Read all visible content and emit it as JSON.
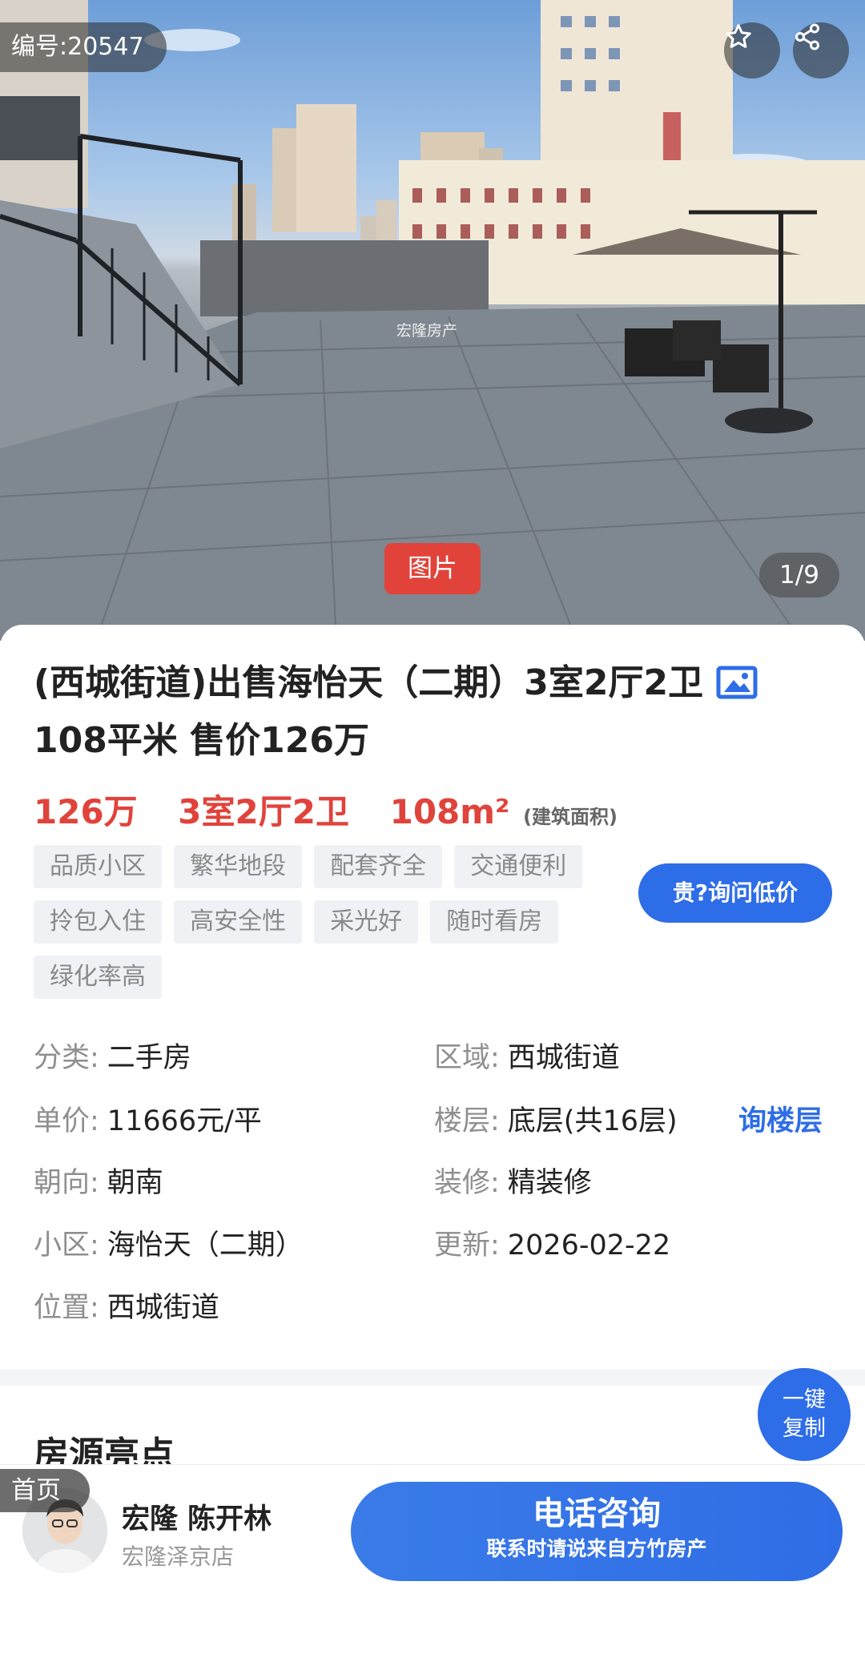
{
  "hero": {
    "listing_id": "编号:20547",
    "watermark": "宏隆房产",
    "photo_tag": "图片",
    "counter": "1/9"
  },
  "title": "(西城街道)出售海怡天（二期）3室2厅2卫",
  "title_line2": "108平米 售价126万",
  "stats": {
    "price": "126万",
    "layout": "3室2厅2卫",
    "area": "108m²",
    "area_note": "(建筑面积)"
  },
  "tags": [
    "品质小区",
    "繁华地段",
    "配套齐全",
    "交通便利",
    "拎包入住",
    "高安全性",
    "采光好",
    "随时看房",
    "绿化率高"
  ],
  "ask_price_button": "贵?询问低价",
  "info": {
    "category": {
      "k": "分类:",
      "v": "二手房"
    },
    "district": {
      "k": "区域:",
      "v": "西城街道"
    },
    "unit_price": {
      "k": "单价:",
      "v": "11666元/平"
    },
    "floor": {
      "k": "楼层:",
      "v": "底层(共16层)"
    },
    "orientation": {
      "k": "朝向:",
      "v": "朝南"
    },
    "decoration": {
      "k": "装修:",
      "v": "精装修"
    },
    "community": {
      "k": "小区:",
      "v": "海怡天（二期）"
    },
    "updated": {
      "k": "更新:",
      "v": "2026-02-22"
    },
    "location": {
      "k": "位置:",
      "v": "西城街道"
    }
  },
  "ask_floor_link": "询楼层",
  "section_title": "房源亮点",
  "copy_button": {
    "line1": "一键",
    "line2": "复制"
  },
  "bottom": {
    "home_label": "首页",
    "agent_name": "宏隆 陈开林",
    "agent_store": "宏隆泽京店",
    "call_main": "电话咨询",
    "call_sub": "联系时请说来自方竹房产"
  },
  "colors": {
    "accent_blue": "#2e6de8",
    "price_red": "#e0433b",
    "tag_bg": "#f0f1f4"
  },
  "icons": [
    "star-icon",
    "share-icon",
    "image-icon"
  ]
}
